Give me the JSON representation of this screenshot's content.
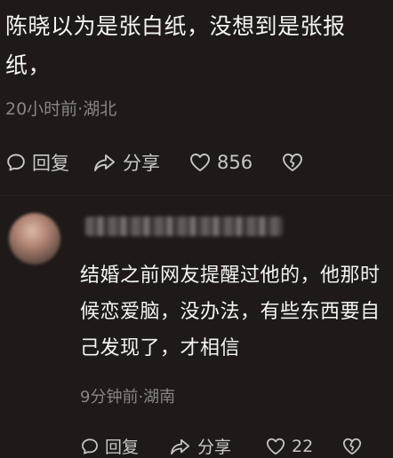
{
  "comment1": {
    "text": "陈晓以为是张白纸，没想到是张报纸，",
    "meta": "20小时前·湖北",
    "actions": {
      "reply": "回复",
      "share": "分享",
      "likes": "856"
    }
  },
  "comment2": {
    "text": "结婚之前网友提醒过他的，他那时候恋爱脑，没办法，有些东西要自己发现了，才相信",
    "meta": "9分钟前·湖南",
    "actions": {
      "reply": "回复",
      "share": "分享",
      "likes": "22"
    }
  },
  "icons": {
    "reply": "comment-bubble-icon",
    "share": "share-arrow-icon",
    "like": "heart-icon",
    "dislike": "broken-heart-icon"
  }
}
